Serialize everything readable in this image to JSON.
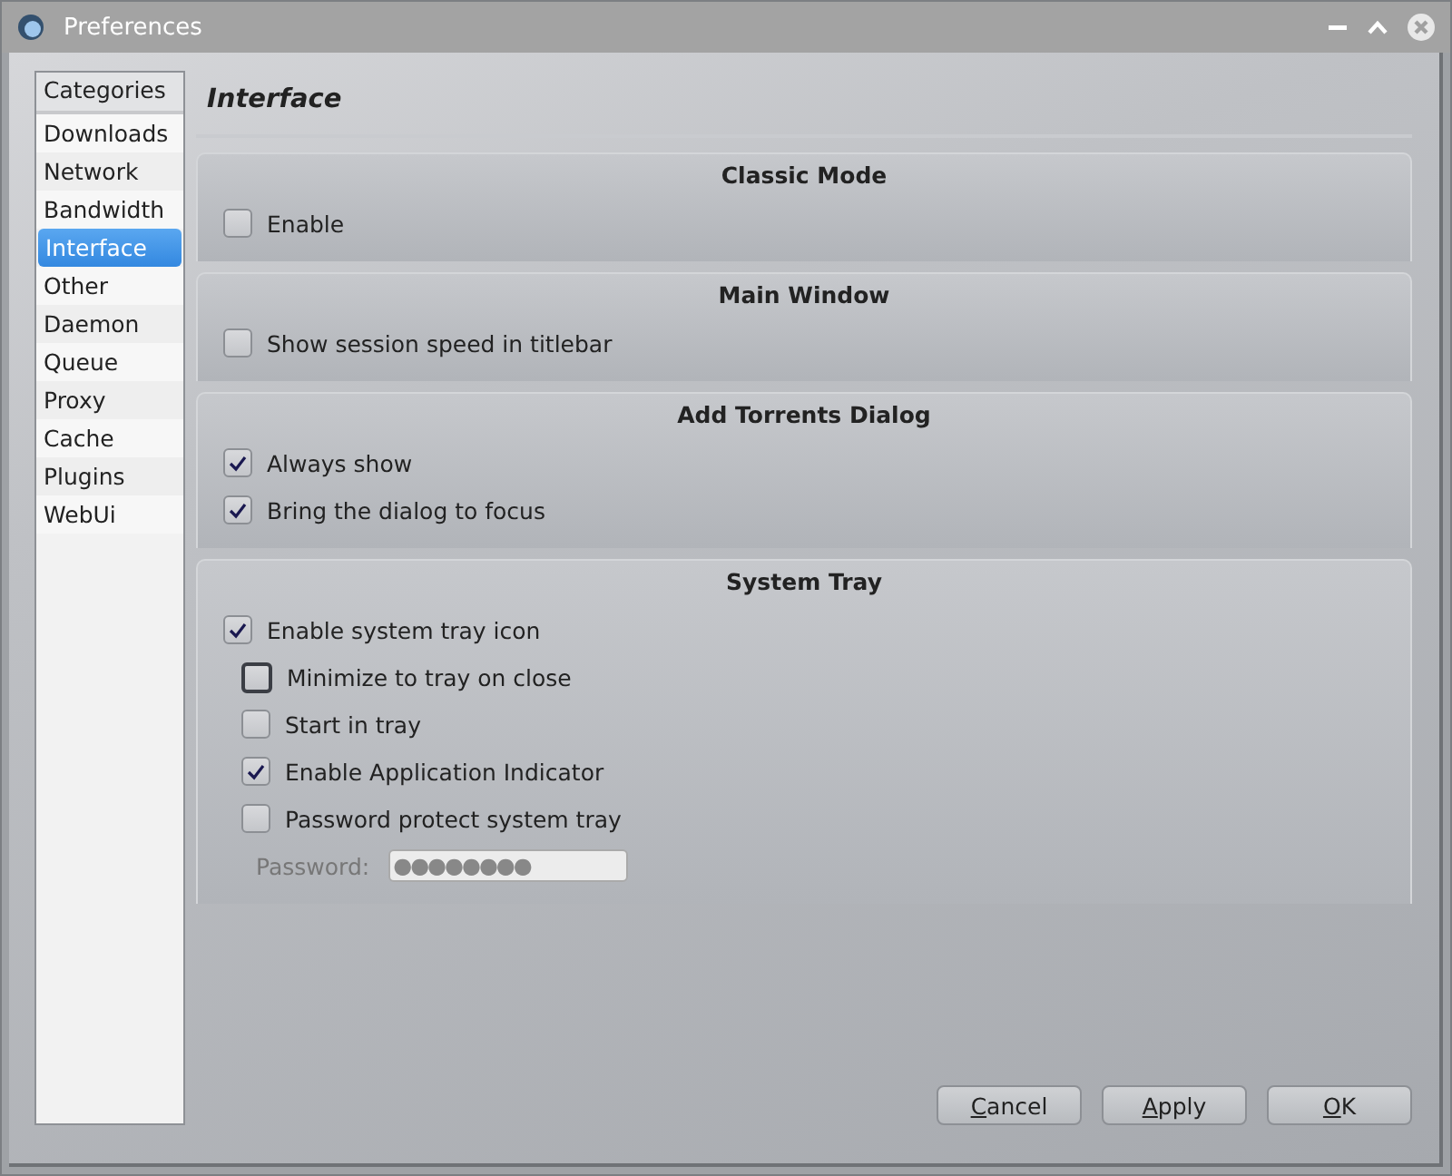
{
  "window": {
    "title": "Preferences"
  },
  "sidebar": {
    "header": "Categories",
    "items": [
      {
        "label": "Downloads",
        "selected": false
      },
      {
        "label": "Network",
        "selected": false
      },
      {
        "label": "Bandwidth",
        "selected": false
      },
      {
        "label": "Interface",
        "selected": true
      },
      {
        "label": "Other",
        "selected": false
      },
      {
        "label": "Daemon",
        "selected": false
      },
      {
        "label": "Queue",
        "selected": false
      },
      {
        "label": "Proxy",
        "selected": false
      },
      {
        "label": "Cache",
        "selected": false
      },
      {
        "label": "Plugins",
        "selected": false
      },
      {
        "label": "WebUi",
        "selected": false
      }
    ]
  },
  "page_title": "Interface",
  "groups": [
    {
      "title": "Classic Mode",
      "options": [
        {
          "label": "Enable",
          "checked": false,
          "focused": false
        }
      ]
    },
    {
      "title": "Main Window",
      "options": [
        {
          "label": "Show session speed in titlebar",
          "checked": false,
          "focused": false
        }
      ]
    },
    {
      "title": "Add Torrents Dialog",
      "options": [
        {
          "label": "Always show",
          "checked": true,
          "focused": false
        },
        {
          "label": "Bring the dialog to focus",
          "checked": true,
          "focused": false
        }
      ]
    },
    {
      "title": "System Tray",
      "options": [
        {
          "label": "Enable system tray icon",
          "checked": true,
          "focused": false,
          "children": [
            {
              "label": "Minimize to tray on close",
              "checked": false,
              "focused": true
            },
            {
              "label": "Start in tray",
              "checked": false,
              "focused": false
            },
            {
              "label": "Enable Application Indicator",
              "checked": true,
              "focused": false
            },
            {
              "label": "Password protect system tray",
              "checked": false,
              "focused": false
            }
          ]
        }
      ],
      "password": {
        "label": "Password:",
        "value": "●●●●●●●●",
        "disabled": true
      }
    }
  ],
  "buttons": [
    {
      "accel": "C",
      "rest": "ancel"
    },
    {
      "accel": "A",
      "rest": "pply"
    },
    {
      "accel": "O",
      "rest": "K"
    }
  ]
}
